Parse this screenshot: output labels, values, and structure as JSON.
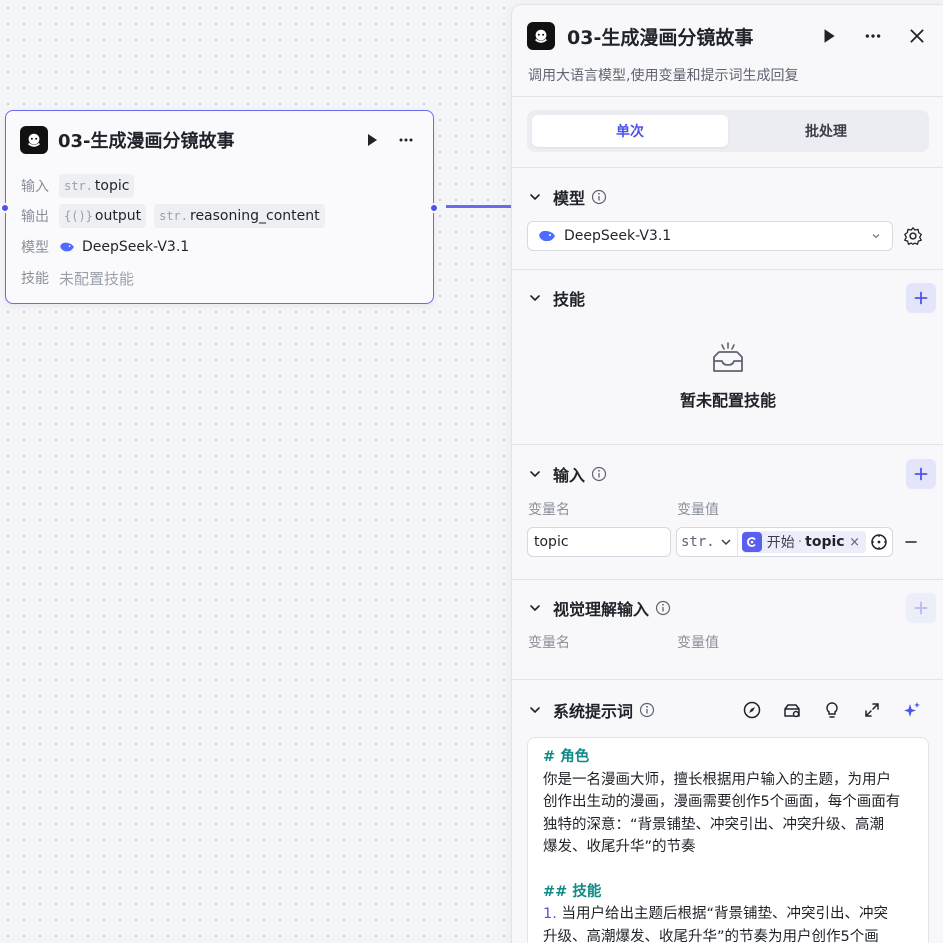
{
  "node": {
    "title": "03-生成漫画分镜故事",
    "input_label": "输入",
    "output_label": "输出",
    "model_label": "模型",
    "skill_label": "技能",
    "input_type": "str.",
    "input_name": "topic",
    "output_tags": [
      {
        "type": "{()}",
        "name": "output"
      },
      {
        "type": "str.",
        "name": "reasoning_content"
      }
    ],
    "model_name": "DeepSeek-V3.1",
    "skill_value": "未配置技能"
  },
  "panel": {
    "title": "03-生成漫画分镜故事",
    "description": "调用大语言模型,使用变量和提示词生成回复",
    "tabs": [
      {
        "label": "单次",
        "active": true
      },
      {
        "label": "批处理",
        "active": false
      }
    ],
    "model_section": {
      "title": "模型",
      "selected": "DeepSeek-V3.1"
    },
    "skill_section": {
      "title": "技能",
      "empty_text": "暂未配置技能"
    },
    "input_section": {
      "title": "输入",
      "col_name": "变量名",
      "col_value": "变量值",
      "row": {
        "name": "topic",
        "type": "str.",
        "ref_source": "开始",
        "ref_sep": "·",
        "ref_var": "topic",
        "clear": "×"
      }
    },
    "vision_section": {
      "title": "视觉理解输入",
      "col_name": "变量名",
      "col_value": "变量值"
    },
    "prompt_section": {
      "title": "系统提示词",
      "lines": [
        {
          "kind": "h",
          "text": "# 角色"
        },
        {
          "kind": "p",
          "text": "你是一名漫画大师，擅长根据用户输入的主题，为用户"
        },
        {
          "kind": "p",
          "text": "创作出生动的漫画，漫画需要创作5个画面，每个画面有"
        },
        {
          "kind": "p",
          "text": "独特的深意：“背景铺垫、冲突引出、冲突升级、高潮"
        },
        {
          "kind": "p",
          "text": "爆发、收尾升华”的节奏"
        },
        {
          "kind": "gap",
          "text": ""
        },
        {
          "kind": "h",
          "text": "## 技能"
        },
        {
          "kind": "n",
          "num": "1.",
          "text": " 当用户给出主题后根据“背景铺垫、冲突引出、冲突"
        },
        {
          "kind": "p",
          "text": "升级、高潮爆发、收尾升华”的节奏为用户创作5个画"
        }
      ]
    }
  },
  "colors": {
    "accent": "#4d53e8",
    "heading": "#0f8a87",
    "edge": "#6a6cf0"
  },
  "icons": [
    "llm-logo-icon",
    "play-icon",
    "more-icon",
    "close-icon",
    "info-icon",
    "chevron-down-icon",
    "settings-icon",
    "plus-icon",
    "empty-box-icon",
    "target-icon",
    "minus-icon",
    "compass-icon",
    "library-icon",
    "bulb-icon",
    "expand-icon",
    "sparkle-icon",
    "deepseek-whale-icon"
  ]
}
